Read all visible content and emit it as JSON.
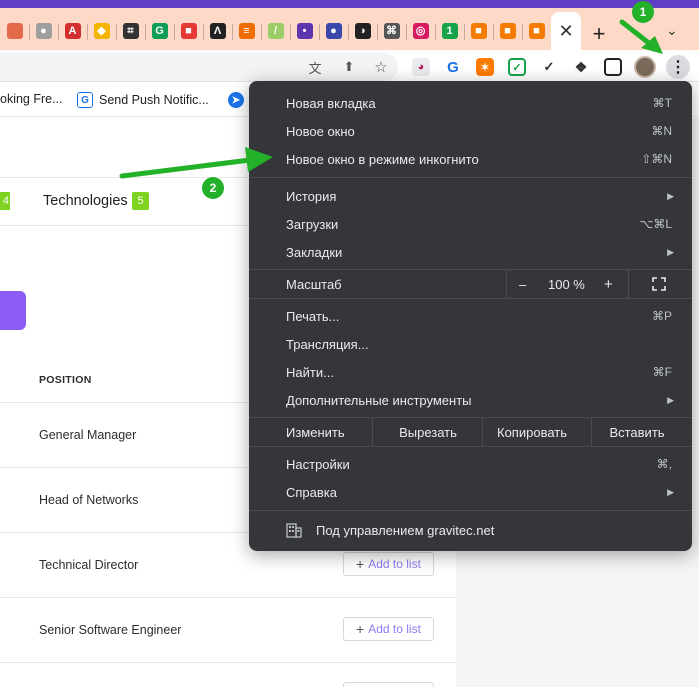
{
  "tab_favicons": [
    {
      "icon": "partial-tab-icon",
      "color": "#e36a4a",
      "glyph": ""
    },
    {
      "icon": "gray-circle-icon",
      "color": "#9e9e9e",
      "glyph": "●"
    },
    {
      "icon": "angular-icon",
      "color": "#d32f2f",
      "glyph": "A"
    },
    {
      "icon": "colorful-diamond-icon",
      "color": "#f4b400",
      "glyph": "◆"
    },
    {
      "icon": "bracket-logo-icon",
      "color": "#333333",
      "glyph": "⌗"
    },
    {
      "icon": "green-g-icon",
      "color": "#0f9d58",
      "glyph": "G"
    },
    {
      "icon": "red-square-icon",
      "color": "#e53935",
      "glyph": "■"
    },
    {
      "icon": "lambda-icon",
      "color": "#222222",
      "glyph": "Λ"
    },
    {
      "icon": "stripes-icon",
      "color": "#ef6c00",
      "glyph": "≡"
    },
    {
      "icon": "slash-icon",
      "color": "#9ccc65",
      "glyph": "/"
    },
    {
      "icon": "dots-icon",
      "color": "#5e35b1",
      "glyph": "•"
    },
    {
      "icon": "blue-orb-icon",
      "color": "#3949ab",
      "glyph": "●"
    },
    {
      "icon": "globe-icon",
      "color": "#222222",
      "glyph": "◑"
    },
    {
      "icon": "knot-icon",
      "color": "#555555",
      "glyph": "⌘"
    },
    {
      "icon": "target-icon",
      "color": "#d81b60",
      "glyph": "◎"
    },
    {
      "icon": "number-one-icon",
      "color": "#16a34a",
      "glyph": "1"
    },
    {
      "icon": "orange-cube-icon",
      "color": "#f57c00",
      "glyph": "■"
    },
    {
      "icon": "orange-cube-icon-2",
      "color": "#f57c00",
      "glyph": "■"
    },
    {
      "icon": "orange-cube-icon-3",
      "color": "#f57c00",
      "glyph": "■"
    }
  ],
  "active_tab_close": "✕",
  "new_tab_glyph": "+",
  "tab_search_glyph": "⌄",
  "bookmarks": [
    {
      "label": "oking Fre...",
      "icon": "none"
    },
    {
      "label": "Send Push Notific...",
      "icon": "g-logo-icon",
      "color": "#1a73e8",
      "glyph": "G"
    },
    {
      "label": "",
      "icon": "compass-icon",
      "color": "#1a73e8",
      "glyph": "➤"
    }
  ],
  "content": {
    "tab_badge_left": "4",
    "technologies_label": "Technologies",
    "technologies_count": "5",
    "column_header": "POSITION",
    "positions": [
      "General Manager",
      "Head of Networks",
      "Technical Director",
      "Senior Software Engineer"
    ],
    "add_to_list": "Add to list",
    "add_plus": "+"
  },
  "menu": {
    "new_tab": {
      "label": "Новая вкладка",
      "shortcut": "⌘T"
    },
    "new_window": {
      "label": "Новое окно",
      "shortcut": "⌘N"
    },
    "incognito": {
      "label": "Новое окно в режиме инкогнито",
      "shortcut": "⇧⌘N"
    },
    "history": {
      "label": "История"
    },
    "downloads": {
      "label": "Загрузки",
      "shortcut": "⌥⌘L"
    },
    "bookmarks": {
      "label": "Закладки"
    },
    "zoom": {
      "label": "Масштаб",
      "minus": "–",
      "value": "100 %",
      "plus": "+"
    },
    "print": {
      "label": "Печать...",
      "shortcut": "⌘P"
    },
    "cast": {
      "label": "Трансляция..."
    },
    "find": {
      "label": "Найти...",
      "shortcut": "⌘F"
    },
    "more_tools": {
      "label": "Дополнительные инструменты"
    },
    "edit": {
      "label": "Изменить",
      "cut": "Вырезать",
      "copy": "Копировать",
      "paste": "Вставить"
    },
    "settings": {
      "label": "Настройки",
      "shortcut": "⌘,"
    },
    "help": {
      "label": "Справка"
    },
    "managed": {
      "label": "Под управлением gravitec.net"
    },
    "submenu_arrow": "▶"
  },
  "annotations": {
    "step1": "1",
    "step2": "2",
    "color": "#23b12a"
  }
}
